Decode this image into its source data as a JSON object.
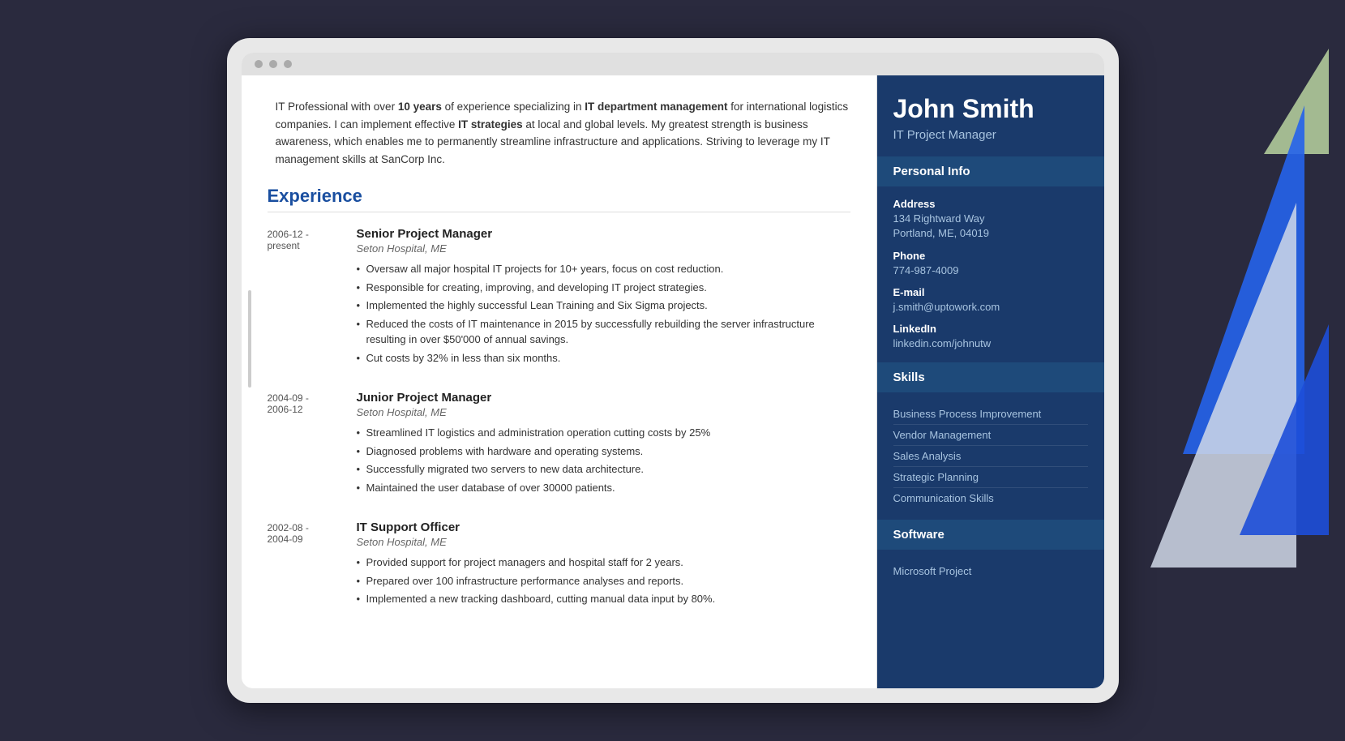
{
  "decorative": {
    "triangles": [
      "green",
      "blue-large",
      "white",
      "blue-small"
    ]
  },
  "resume": {
    "sidebar": {
      "name": "John Smith",
      "job_title": "IT Project Manager",
      "personal_info_label": "Personal Info",
      "address_label": "Address",
      "address_line1": "134 Rightward Way",
      "address_line2": "Portland, ME, 04019",
      "phone_label": "Phone",
      "phone": "774-987-4009",
      "email_label": "E-mail",
      "email": "j.smith@uptowork.com",
      "linkedin_label": "LinkedIn",
      "linkedin": "linkedin.com/johnutw",
      "skills_label": "Skills",
      "skills": [
        "Business Process Improvement",
        "Vendor Management",
        "Sales Analysis",
        "Strategic Planning",
        "Communication Skills"
      ],
      "software_label": "Software",
      "software_items": [
        "Microsoft Project"
      ]
    },
    "summary": "IT Professional with over 10 years of experience specializing in IT department management for international logistics companies. I can implement effective IT strategies at local and global levels. My greatest strength is business awareness, which enables me to permanently streamline infrastructure and applications. Striving to leverage my IT management skills at SanCorp Inc.",
    "experience_label": "Experience",
    "jobs": [
      {
        "date": "2006-12 - present",
        "title": "Senior Project Manager",
        "company": "Seton Hospital, ME",
        "bullets": [
          "Oversaw all major hospital IT projects for 10+ years, focus on cost reduction.",
          "Responsible for creating, improving, and developing IT project strategies.",
          "Implemented the highly successful Lean Training and Six Sigma projects.",
          "Reduced the costs of IT maintenance in 2015 by successfully rebuilding the server infrastructure resulting in over $50'000 of annual savings.",
          "Cut costs by 32% in less than six months."
        ]
      },
      {
        "date": "2004-09 - 2006-12",
        "title": "Junior Project Manager",
        "company": "Seton Hospital, ME",
        "bullets": [
          "Streamlined IT logistics and administration operation cutting costs by 25%",
          "Diagnosed problems with hardware and operating systems.",
          "Successfully migrated two servers to new data architecture.",
          "Maintained the user database of over 30000 patients."
        ]
      },
      {
        "date": "2002-08 - 2004-09",
        "title": "IT Support Officer",
        "company": "Seton Hospital, ME",
        "bullets": [
          "Provided support for project managers and hospital staff for 2 years.",
          "Prepared over 100 infrastructure performance analyses and reports.",
          "Implemented a new tracking dashboard, cutting manual data input by 80%."
        ]
      }
    ]
  }
}
